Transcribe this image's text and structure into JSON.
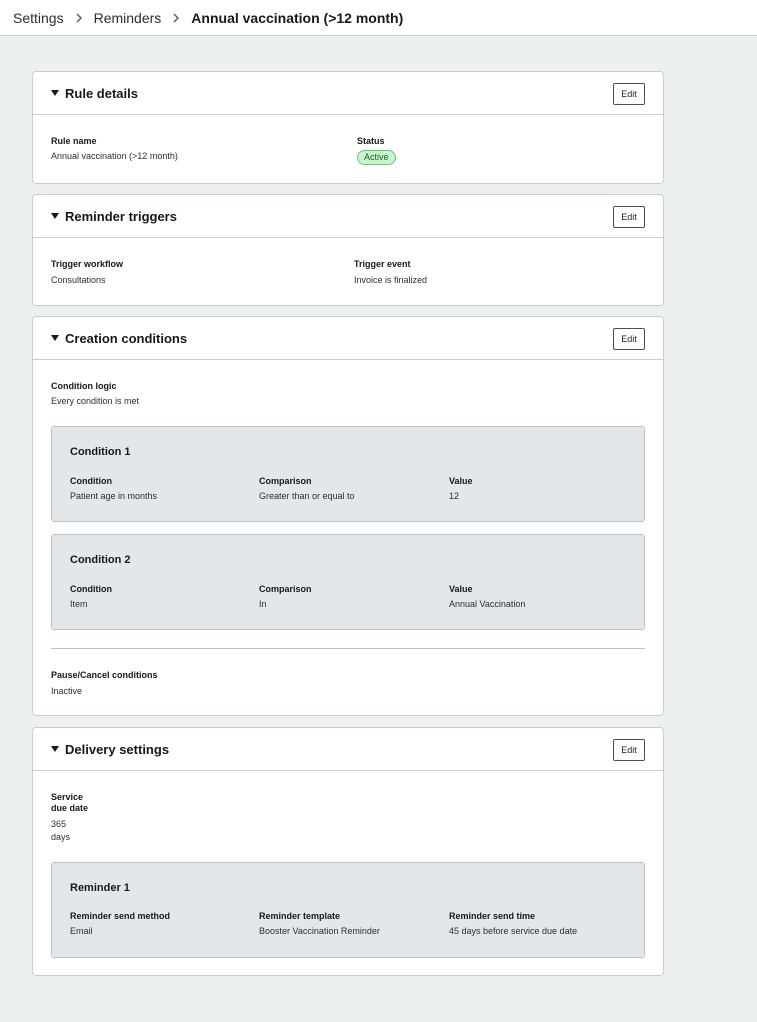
{
  "breadcrumb": {
    "items": [
      "Settings",
      "Reminders"
    ],
    "current": "Annual vaccination (>12 month)"
  },
  "rule_details": {
    "title": "Rule details",
    "edit_label": "Edit",
    "rule_name_label": "Rule name",
    "rule_name_value": "Annual vaccination (>12 month)",
    "status_label": "Status",
    "status_value": "Active",
    "status_color": "#c9f5cd"
  },
  "reminder_triggers": {
    "title": "Reminder triggers",
    "edit_label": "Edit",
    "workflow_label": "Trigger workflow",
    "workflow_value": "Consultations",
    "event_label": "Trigger event",
    "event_value": "Invoice is finalized"
  },
  "creation_conditions": {
    "title": "Creation conditions",
    "edit_label": "Edit",
    "logic_label": "Condition logic",
    "logic_value": "Every condition is met",
    "conditions": [
      {
        "title": "Condition 1",
        "condition_label": "Condition",
        "condition_value": "Patient age in months",
        "comparison_label": "Comparison",
        "comparison_value": "Greater than or equal to",
        "value_label": "Value",
        "value_value": "12"
      },
      {
        "title": "Condition 2",
        "condition_label": "Condition",
        "condition_value": "Item",
        "comparison_label": "Comparison",
        "comparison_value": "In",
        "value_label": "Value",
        "value_value": "Annual Vaccination"
      }
    ],
    "pause_label": "Pause/Cancel conditions",
    "pause_value": "Inactive"
  },
  "delivery_settings": {
    "title": "Delivery settings",
    "edit_label": "Edit",
    "service_label_line1": "Service",
    "service_label_line2": "due date",
    "service_value_line1": "365",
    "service_value_line2": "days",
    "reminders": [
      {
        "title": "Reminder 1",
        "method_label": "Reminder send method",
        "method_value": "Email",
        "template_label": "Reminder template",
        "template_value": "Booster Vaccination Reminder",
        "time_label": "Reminder send time",
        "time_value": "45 days before service due date"
      }
    ]
  },
  "icons": {
    "breadcrumb_separator": "chevron-right-icon",
    "section_toggle": "caret-down-icon"
  }
}
